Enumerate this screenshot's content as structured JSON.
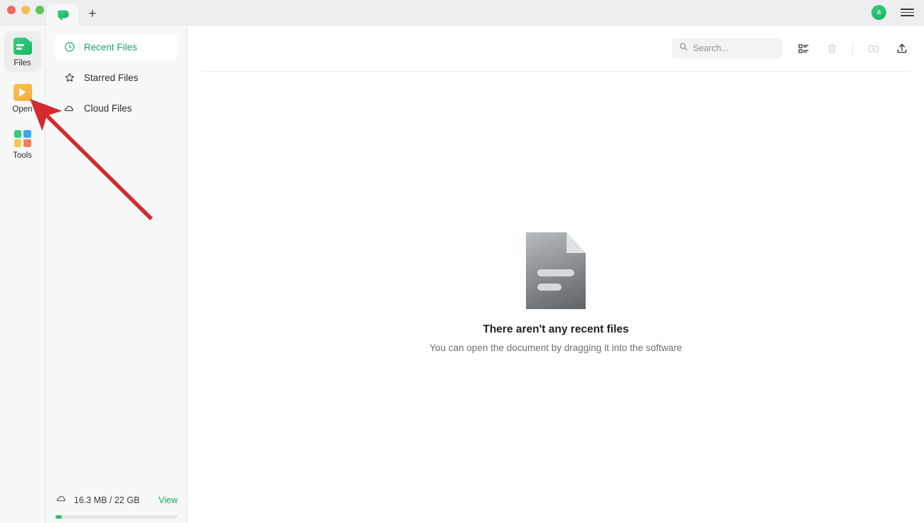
{
  "window": {
    "traffic_lights": [
      "close",
      "minimize",
      "maximize"
    ],
    "new_tab_label": "+",
    "avatar_initial": "a",
    "logo_name": "app-logo"
  },
  "rail": {
    "items": [
      {
        "label": "Files",
        "icon": "files-icon",
        "active": true
      },
      {
        "label": "Open",
        "icon": "open-play-icon",
        "active": false
      },
      {
        "label": "Tools",
        "icon": "tools-grid-icon",
        "active": false
      }
    ]
  },
  "sidebar": {
    "nav": [
      {
        "label": "Recent Files",
        "icon": "clock-icon",
        "active": true
      },
      {
        "label": "Starred Files",
        "icon": "star-icon",
        "active": false
      },
      {
        "label": "Cloud Files",
        "icon": "cloud-icon",
        "active": false
      }
    ],
    "storage": {
      "icon": "cloud-icon",
      "usage_text": "16.3 MB / 22 GB",
      "view_label": "View",
      "percent": 5.5
    }
  },
  "toolbar": {
    "search": {
      "placeholder": "Search...",
      "value": ""
    },
    "icons": [
      {
        "name": "list-view-icon",
        "enabled": true
      },
      {
        "name": "trash-icon",
        "enabled": false
      },
      {
        "name": "new-folder-icon",
        "enabled": false
      },
      {
        "name": "upload-icon",
        "enabled": true
      }
    ]
  },
  "main": {
    "empty_state": {
      "icon": "document-icon",
      "title": "There aren't any recent files",
      "subtitle": "You can open the document by dragging it into the software"
    }
  },
  "annotation": {
    "arrow_color": "#d32b2b",
    "points_to": "open-rail-item"
  },
  "colors": {
    "accent_green": "#1aa566",
    "open_orange": "#f2a93a",
    "annotation_red": "#d32b2b"
  }
}
